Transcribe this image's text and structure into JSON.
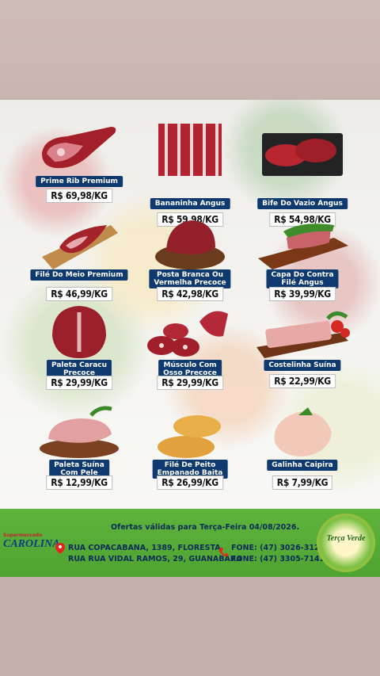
{
  "products": [
    {
      "name": "Prime Rib Premium",
      "price": "R$ 69,98/KG"
    },
    {
      "name": "Bananinha Angus",
      "price": "R$ 59,98/KG"
    },
    {
      "name": "Bife Do Vazio Angus",
      "price": "R$ 54,98/KG"
    },
    {
      "name": "Filé Do Meio Premium",
      "price": "R$ 46,99/KG"
    },
    {
      "name": "Posta Branca Ou Vermelha Precoce",
      "price": "R$ 42,98/KG"
    },
    {
      "name": "Capa Do Contra Filé Angus",
      "price": "R$ 39,99/KG"
    },
    {
      "name": "Paleta Caracu Precoce",
      "price": "R$ 29,99/KG"
    },
    {
      "name": "Músculo Com Osso Precoce",
      "price": "R$ 29,99/KG"
    },
    {
      "name": "Costelinha Suína",
      "price": "R$ 22,99/KG"
    },
    {
      "name": "Paleta Suína Com Pele",
      "price": "R$ 12,99/KG"
    },
    {
      "name": "Filé De Peito Empanado Baita",
      "price": "R$ 26,99/KG"
    },
    {
      "name": "Galinha Caipira",
      "price": "R$ 7,99/KG"
    }
  ],
  "footer": {
    "store": "CAROLINA",
    "store_top": "Supermercado",
    "offer": "Ofertas válidas para Terça-Feira 04/08/2026.",
    "address1": "RUA COPACABANA, 1389, FLORESTA",
    "address2": "RUA RUA VIDAL RAMOS, 29, GUANABARA",
    "phone1": "FONE: (47) 3026-3129",
    "phone2": "FONE: (47) 3305-7141",
    "badge": "Terça Verde"
  }
}
